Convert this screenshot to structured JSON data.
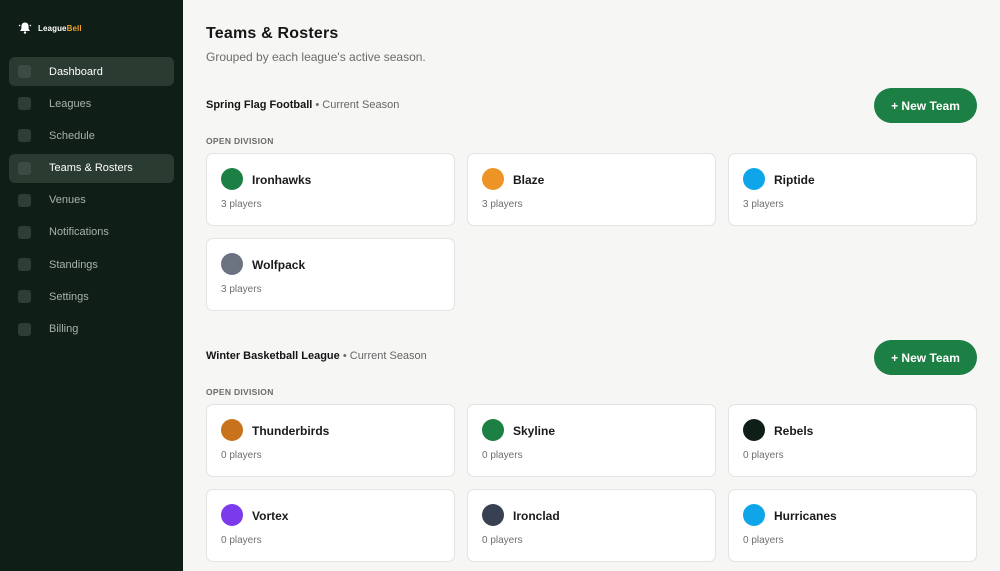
{
  "brand": {
    "name_part1": "League",
    "name_part2": "Bell",
    "accent_color": "#f0a02c"
  },
  "sidebar": {
    "items": [
      {
        "label": "Dashboard",
        "active": true
      },
      {
        "label": "Leagues",
        "active": false
      },
      {
        "label": "Schedule",
        "active": false
      },
      {
        "label": "Teams & Rosters",
        "active": true
      },
      {
        "label": "Venues",
        "active": false
      },
      {
        "label": "Notifications",
        "active": false
      },
      {
        "label": "Standings",
        "active": false
      },
      {
        "label": "Settings",
        "active": false
      },
      {
        "label": "Billing",
        "active": false
      }
    ]
  },
  "page": {
    "title": "Teams & Rosters",
    "subtitle": "Grouped by each league's active season."
  },
  "leagues": [
    {
      "name": "Spring Flag Football",
      "season": " • Current Season",
      "button_label": "+ New Team",
      "division": "OPEN DIVISION",
      "teams": [
        {
          "name": "Ironhawks",
          "players": "3 players",
          "color": "#1c7f43"
        },
        {
          "name": "Blaze",
          "players": "3 players",
          "color": "#ee9326"
        },
        {
          "name": "Riptide",
          "players": "3 players",
          "color": "#0ea5e9"
        },
        {
          "name": "Wolfpack",
          "players": "3 players",
          "color": "#6b7280"
        }
      ]
    },
    {
      "name": "Winter Basketball League",
      "season": " • Current Season",
      "button_label": "+ New Team",
      "division": "OPEN DIVISION",
      "teams": [
        {
          "name": "Thunderbirds",
          "players": "0 players",
          "color": "#c8731b"
        },
        {
          "name": "Skyline",
          "players": "0 players",
          "color": "#1c7f43"
        },
        {
          "name": "Rebels",
          "players": "0 players",
          "color": "#0f1f17"
        },
        {
          "name": "Vortex",
          "players": "0 players",
          "color": "#7c3aed"
        },
        {
          "name": "Ironclad",
          "players": "0 players",
          "color": "#374151"
        },
        {
          "name": "Hurricanes",
          "players": "0 players",
          "color": "#0ea5e9"
        }
      ]
    }
  ]
}
